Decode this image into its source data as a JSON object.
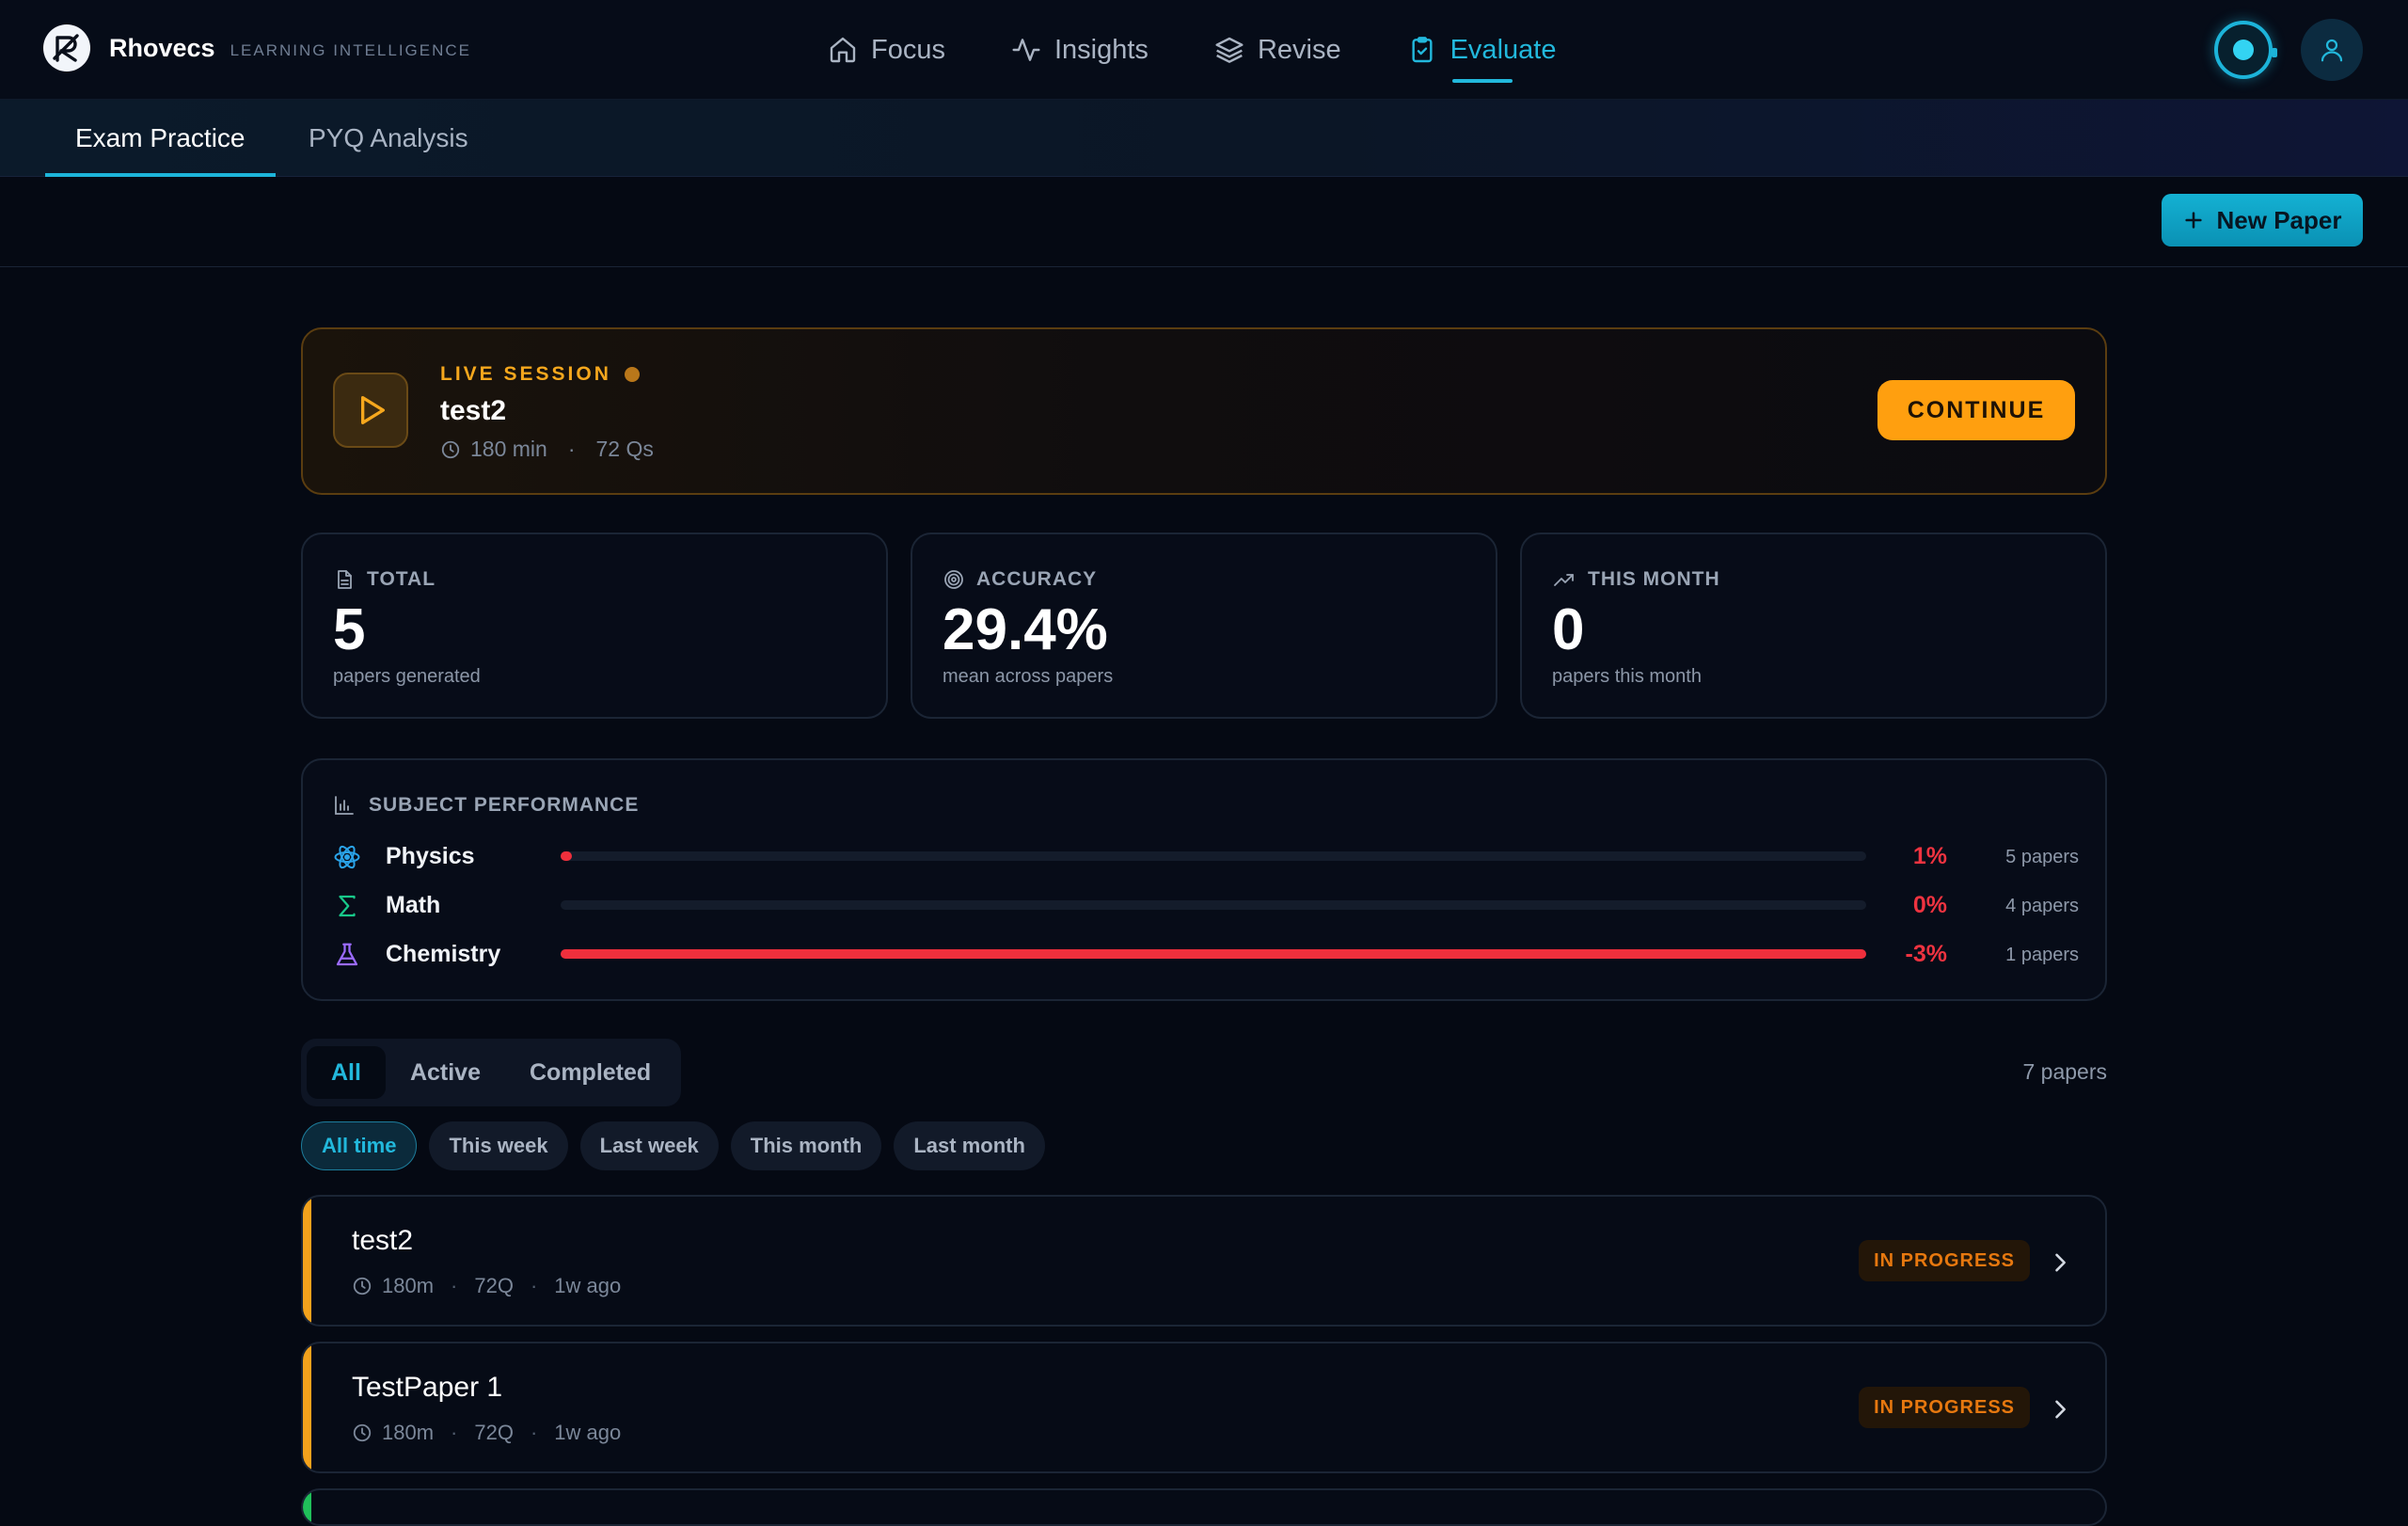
{
  "app": {
    "name": "Rhovecs",
    "tagline": "LEARNING INTELLIGENCE"
  },
  "nav": {
    "items": [
      {
        "label": "Focus",
        "icon": "home-icon"
      },
      {
        "label": "Insights",
        "icon": "activity-icon"
      },
      {
        "label": "Revise",
        "icon": "layers-icon"
      },
      {
        "label": "Evaluate",
        "icon": "clipboard-check-icon",
        "active": true
      }
    ]
  },
  "subtabs": [
    {
      "label": "Exam Practice",
      "active": true
    },
    {
      "label": "PYQ Analysis"
    }
  ],
  "toolbar": {
    "new_paper_label": "New Paper"
  },
  "live_session": {
    "label": "LIVE SESSION",
    "title": "test2",
    "duration": "180 min",
    "separator": "·",
    "questions": "72 Qs",
    "continue_label": "CONTINUE"
  },
  "stats": [
    {
      "head": "TOTAL",
      "value": "5",
      "caption": "papers generated",
      "icon": "document-icon"
    },
    {
      "head": "ACCURACY",
      "value": "29.4%",
      "caption": "mean across papers",
      "icon": "target-icon"
    },
    {
      "head": "THIS MONTH",
      "value": "0",
      "caption": "papers this month",
      "icon": "trending-up-icon"
    }
  ],
  "performance": {
    "title": "SUBJECT PERFORMANCE",
    "subjects": [
      {
        "name": "Physics",
        "pct": "1%",
        "value": 1,
        "count": "5 papers",
        "icon": "atom-icon",
        "color": "#2aa3e8"
      },
      {
        "name": "Math",
        "pct": "0%",
        "value": 0,
        "count": "4 papers",
        "icon": "sigma-icon",
        "color": "#18c98a"
      },
      {
        "name": "Chemistry",
        "pct": "-3%",
        "value": -3,
        "count": "1 papers",
        "icon": "flask-icon",
        "color": "#9b6bff"
      }
    ]
  },
  "filters": {
    "segments": [
      {
        "label": "All",
        "active": true
      },
      {
        "label": "Active"
      },
      {
        "label": "Completed"
      }
    ],
    "paper_count": "7 papers",
    "chips": [
      {
        "label": "All time",
        "active": true
      },
      {
        "label": "This week"
      },
      {
        "label": "Last week"
      },
      {
        "label": "This month"
      },
      {
        "label": "Last month"
      }
    ]
  },
  "papers": [
    {
      "title": "test2",
      "duration": "180m",
      "questions": "72Q",
      "age": "1w ago",
      "status": "IN PROGRESS",
      "dot": "·"
    },
    {
      "title": "TestPaper 1",
      "duration": "180m",
      "questions": "72Q",
      "age": "1w ago",
      "status": "IN PROGRESS",
      "dot": "·"
    }
  ],
  "colors": {
    "accent": "#22b8dc",
    "live": "#ff9f0f",
    "negative": "#ef2f3c",
    "in_progress_accent": "#f4a21c"
  }
}
